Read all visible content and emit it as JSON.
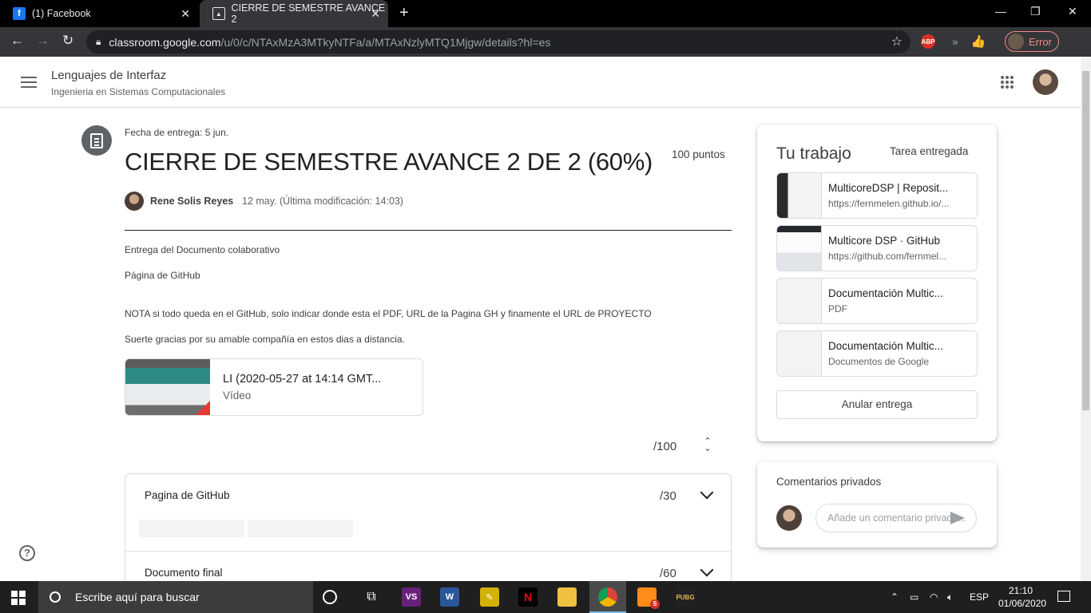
{
  "browser": {
    "tabs": [
      {
        "label": "(1) Facebook",
        "icon": "facebook-icon"
      },
      {
        "label": "CIERRE DE SEMESTRE AVANCE 2",
        "icon": "classroom-icon"
      }
    ],
    "url_host": "classroom.google.com",
    "url_path": "/u/0/c/NTAxMzA3MTkyNTFa/a/MTAxNzlyMTQ1Mjgw/details?hl=es",
    "ext_abp": "ABP",
    "profile_status": "Error"
  },
  "classroom": {
    "course_title": "Lenguajes de Interfaz",
    "course_subtitle": "Ingenieria en Sistemas Computacionales"
  },
  "assignment": {
    "due": "Fecha de entrega: 5 jun.",
    "title": "CIERRE DE SEMESTRE AVANCE 2 DE 2 (60%)",
    "points": "100 puntos",
    "author": "Rene Solis Reyes",
    "posted": "12 may. (Última modificación: 14:03)",
    "description": [
      "Entrega del Documento colaborativo",
      "Página de GitHub",
      "NOTA si todo queda en el GitHub, solo indicar donde esta el PDF, URL de la Pagina GH y finamente el URL de PROYECTO",
      "Suerte gracias por su amable compañía en estos dias a distancia."
    ],
    "attachment": {
      "name": "LI (2020-05-27 at 14:14 GMT...",
      "type": "Vídeo"
    },
    "grade": "/100",
    "rubric": [
      {
        "name": "Pagina de GitHub",
        "score": "/30"
      },
      {
        "name": "Documento final",
        "score": "/60"
      }
    ]
  },
  "work": {
    "title": "Tu trabajo",
    "status": "Tarea entregada",
    "items": [
      {
        "name": "MulticoreDSP | Reposit...",
        "sub": "https://fernmelen.github.io/..."
      },
      {
        "name": "Multicore DSP · GitHub",
        "sub": "https://github.com/fernmel..."
      },
      {
        "name": "Documentación Multic...",
        "sub": "PDF"
      },
      {
        "name": "Documentación Multic...",
        "sub": "Documentos de Google"
      }
    ],
    "unsubmit_label": "Anular entrega"
  },
  "comments": {
    "title": "Comentarios privados",
    "placeholder": "Añade un comentario privado..."
  },
  "taskbar": {
    "search_placeholder": "Escribe aquí para buscar",
    "discord_badge": "5",
    "language": "ESP",
    "time": "21:10",
    "date": "01/06/2020"
  }
}
